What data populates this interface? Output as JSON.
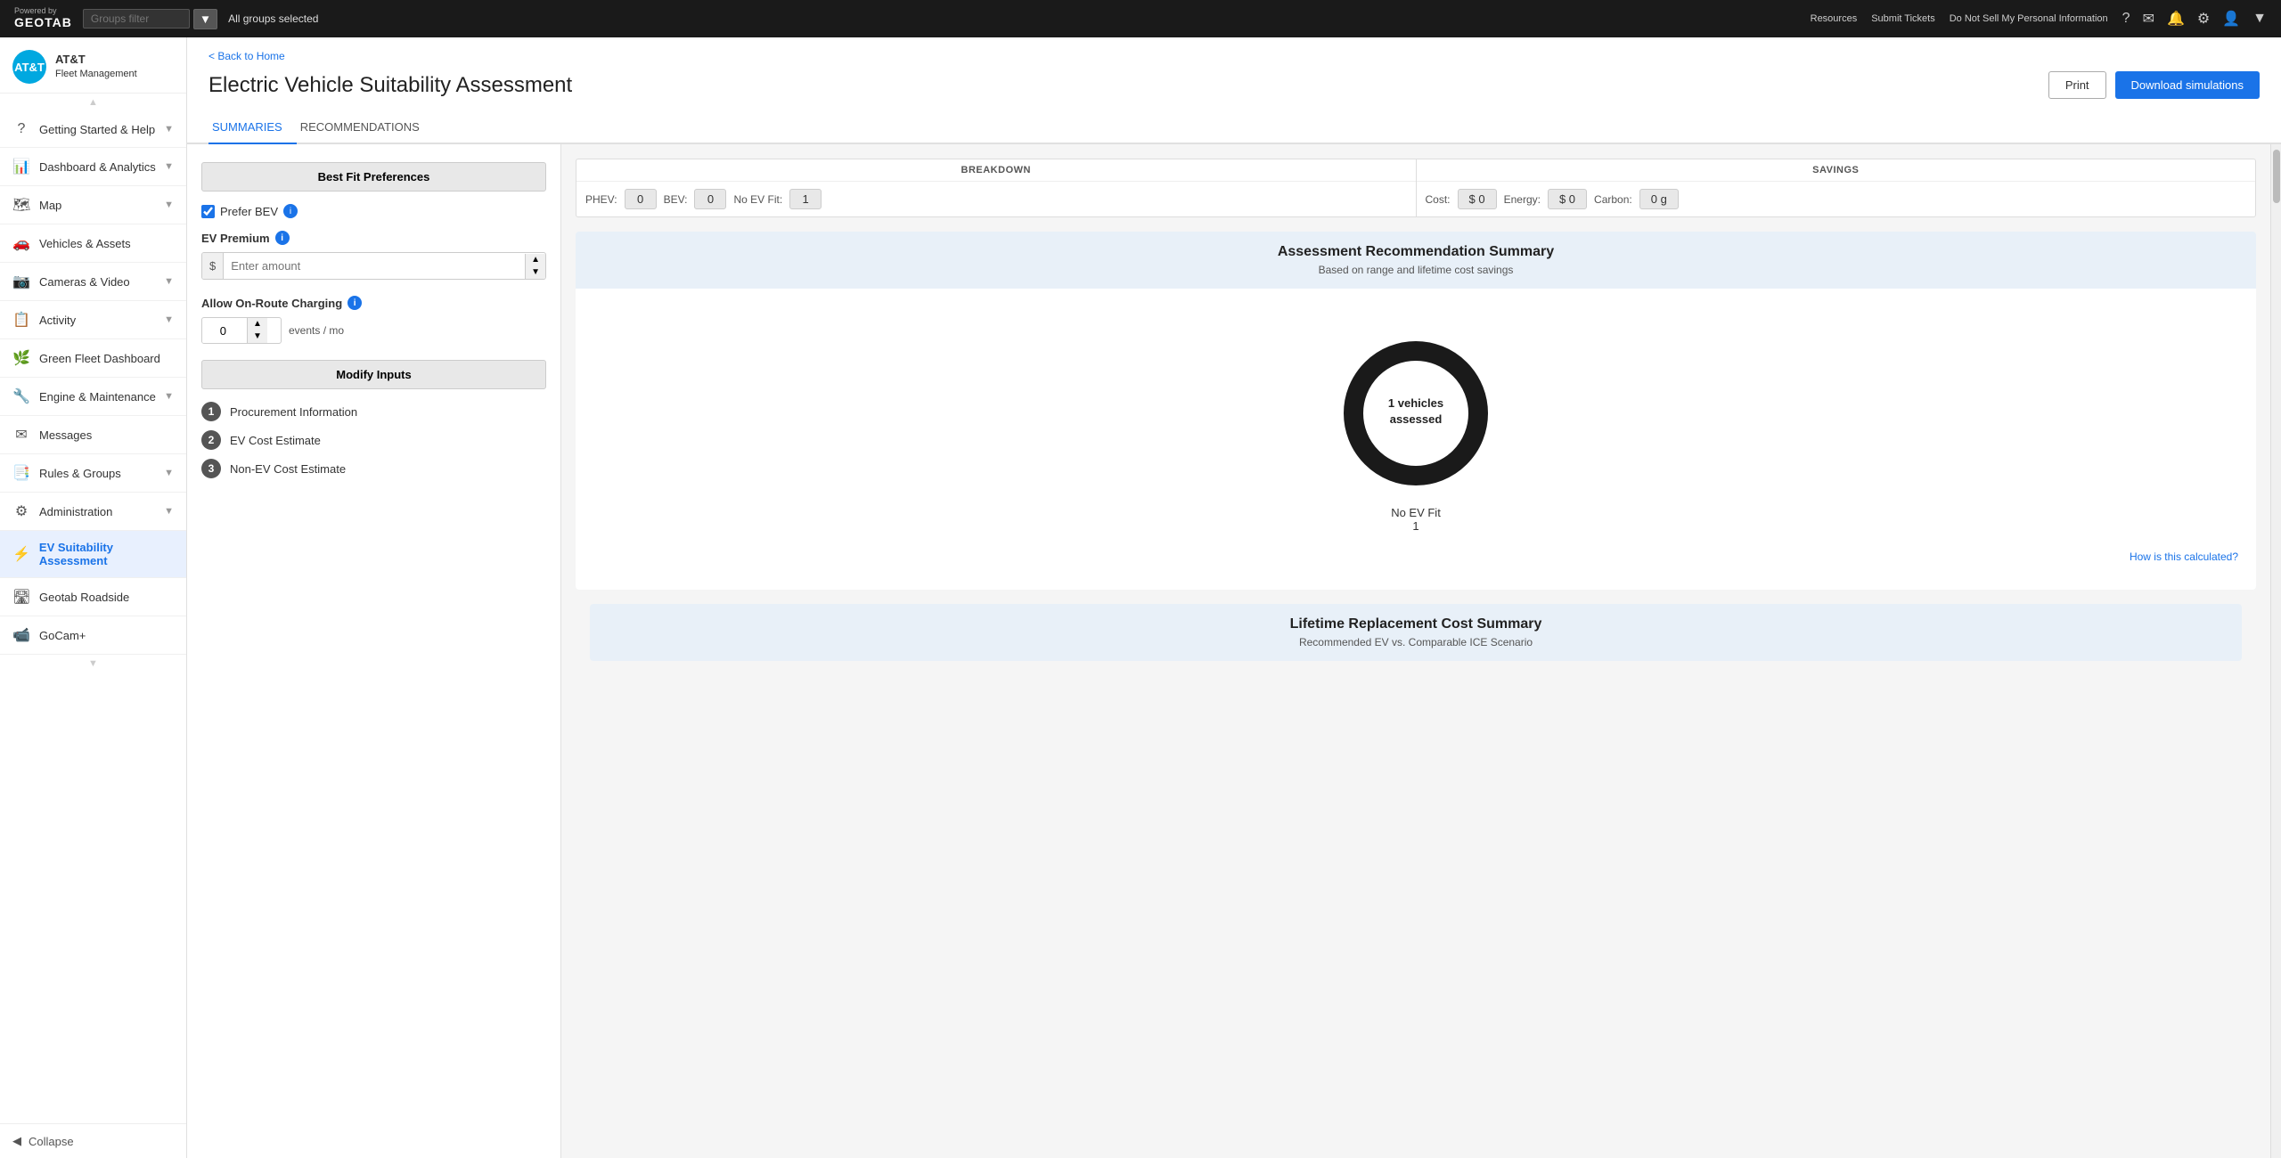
{
  "topbar": {
    "logo_powered": "Powered by",
    "logo_brand": "GEOTAB",
    "links": [
      "Resources",
      "Submit Tickets",
      "Do Not Sell My Personal Information"
    ],
    "groups_filter_placeholder": "Groups filter",
    "all_groups_text": "All groups selected"
  },
  "sidebar": {
    "logo_company": "AT&T",
    "logo_subtitle": "Fleet Management",
    "items": [
      {
        "id": "getting-started",
        "label": "Getting Started & Help",
        "icon": "?",
        "has_chevron": true
      },
      {
        "id": "dashboard",
        "label": "Dashboard & Analytics",
        "icon": "📊",
        "has_chevron": true
      },
      {
        "id": "map",
        "label": "Map",
        "icon": "🗺",
        "has_chevron": true
      },
      {
        "id": "vehicles",
        "label": "Vehicles & Assets",
        "icon": "🚗",
        "has_chevron": false
      },
      {
        "id": "cameras",
        "label": "Cameras & Video",
        "icon": "📷",
        "has_chevron": true
      },
      {
        "id": "activity",
        "label": "Activity",
        "icon": "📋",
        "has_chevron": true
      },
      {
        "id": "green-fleet",
        "label": "Green Fleet Dashboard",
        "icon": "🌿",
        "has_chevron": false
      },
      {
        "id": "engine",
        "label": "Engine & Maintenance",
        "icon": "🔧",
        "has_chevron": true
      },
      {
        "id": "messages",
        "label": "Messages",
        "icon": "✉",
        "has_chevron": false
      },
      {
        "id": "rules",
        "label": "Rules & Groups",
        "icon": "📑",
        "has_chevron": true
      },
      {
        "id": "administration",
        "label": "Administration",
        "icon": "⚙",
        "has_chevron": true
      },
      {
        "id": "ev-suitability",
        "label": "EV Suitability Assessment",
        "icon": "⚡",
        "has_chevron": false,
        "active": true
      },
      {
        "id": "geotab-roadside",
        "label": "Geotab Roadside",
        "icon": "🛣",
        "has_chevron": false
      },
      {
        "id": "gocam",
        "label": "GoCam+",
        "icon": "📹",
        "has_chevron": false
      }
    ],
    "collapse_label": "Collapse"
  },
  "page": {
    "back_link": "< Back to Home",
    "title": "Electric Vehicle Suitability Assessment",
    "btn_print": "Print",
    "btn_download": "Download simulations"
  },
  "tabs": [
    {
      "id": "summaries",
      "label": "SUMMARIES",
      "active": true
    },
    {
      "id": "recommendations",
      "label": "RECOMMENDATIONS",
      "active": false
    }
  ],
  "left_panel": {
    "best_fit_header": "Best Fit Preferences",
    "prefer_bev_label": "Prefer BEV",
    "prefer_bev_checked": true,
    "ev_premium_label": "EV Premium",
    "amount_placeholder": "Enter amount",
    "allow_onroute_label": "Allow On-Route Charging",
    "onroute_value": "0",
    "events_unit": "events / mo",
    "modify_inputs_header": "Modify Inputs",
    "modify_items": [
      {
        "num": "1",
        "label": "Procurement Information"
      },
      {
        "num": "2",
        "label": "EV Cost Estimate"
      },
      {
        "num": "3",
        "label": "Non-EV Cost Estimate"
      }
    ]
  },
  "breakdown": {
    "title": "BREAKDOWN",
    "items": [
      {
        "label": "PHEV:",
        "value": "0"
      },
      {
        "label": "BEV:",
        "value": "0"
      },
      {
        "label": "No EV Fit:",
        "value": "1"
      }
    ],
    "savings_title": "SAVINGS",
    "savings_items": [
      {
        "label": "Cost:",
        "value": "$ 0"
      },
      {
        "label": "Energy:",
        "value": "$ 0"
      },
      {
        "label": "Carbon:",
        "value": "0 g"
      }
    ]
  },
  "assessment_summary": {
    "title": "Assessment Recommendation Summary",
    "subtitle": "Based on range and lifetime cost savings",
    "donut": {
      "center_line1": "1 vehicles",
      "center_line2": "assessed",
      "legend_label": "No EV Fit",
      "legend_value": "1",
      "no_ev_fit_count": 1,
      "total": 1
    },
    "how_calculated": "How is this calculated?"
  },
  "lifetime_section": {
    "title": "Lifetime Replacement Cost Summary",
    "subtitle": "Recommended EV vs. Comparable ICE Scenario"
  }
}
